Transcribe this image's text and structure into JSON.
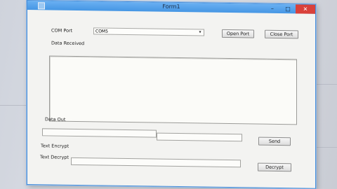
{
  "window": {
    "title": "Form1",
    "minimize_glyph": "–",
    "maximize_glyph": "□",
    "close_glyph": "✕"
  },
  "com_port": {
    "label": "COM Port",
    "selected": "COM5",
    "open_port_label": "Open Port",
    "close_port_label": "Close Port"
  },
  "received": {
    "label": "Data Received",
    "text": ""
  },
  "data_out": {
    "label": "Data Out",
    "value_left": "",
    "value_right": "",
    "send_label": "Send"
  },
  "encrypt": {
    "label": "Text Encrypt"
  },
  "decrypt": {
    "label": "Text Decrypt",
    "value": "",
    "button_label": "Decrypt"
  },
  "icons": [
    "app-icon",
    "chevron-down-icon",
    "minimize-icon",
    "maximize-icon",
    "close-icon"
  ]
}
